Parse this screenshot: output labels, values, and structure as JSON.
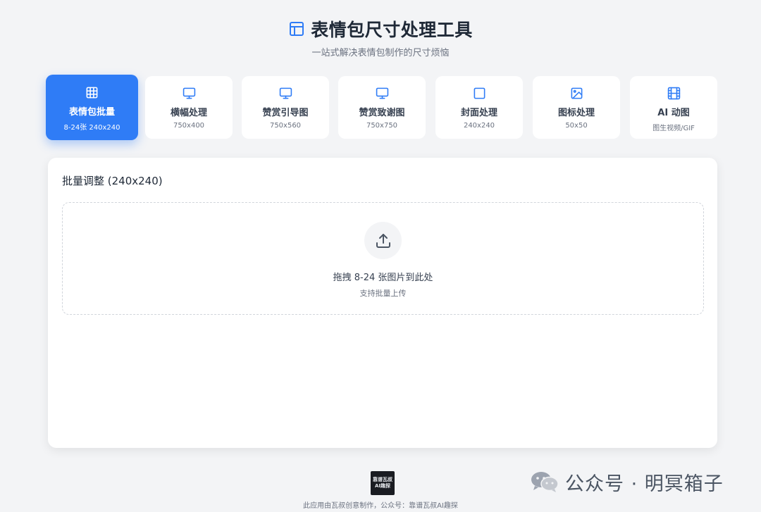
{
  "header": {
    "title": "表情包尺寸处理工具",
    "subtitle": "一站式解决表情包制作的尺寸烦恼"
  },
  "tabs": [
    {
      "label": "表情包批量",
      "size": "8-24张 240x240",
      "icon": "grid-icon",
      "active": true
    },
    {
      "label": "横幅处理",
      "size": "750x400",
      "icon": "monitor-icon",
      "active": false
    },
    {
      "label": "赞赏引导图",
      "size": "750x560",
      "icon": "monitor-icon",
      "active": false
    },
    {
      "label": "赞赏致谢图",
      "size": "750x750",
      "icon": "monitor-icon",
      "active": false
    },
    {
      "label": "封面处理",
      "size": "240x240",
      "icon": "square-icon",
      "active": false
    },
    {
      "label": "图标处理",
      "size": "50x50",
      "icon": "image-icon",
      "active": false
    },
    {
      "label": "AI 动图",
      "size": "图生视频/GIF",
      "icon": "film-icon",
      "active": false
    }
  ],
  "main": {
    "title": "批量调整 (240x240)",
    "dropzone": {
      "icon": "upload-icon",
      "text": "拖拽 8-24 张图片到此处",
      "hint": "支持批量上传"
    }
  },
  "footer": {
    "logo_text": "靠谱瓦叔AI趣探",
    "text": "此应用由瓦叔创意制作，公众号：靠谱瓦叔AI趣探"
  },
  "watermark": {
    "icon": "wechat-icon",
    "text": "公众号 · 明冥箱子"
  },
  "colors": {
    "accent": "#2f7cf6",
    "background": "#f3f4f6",
    "card": "#ffffff",
    "text": "#1f2937",
    "muted": "#6b7280"
  }
}
